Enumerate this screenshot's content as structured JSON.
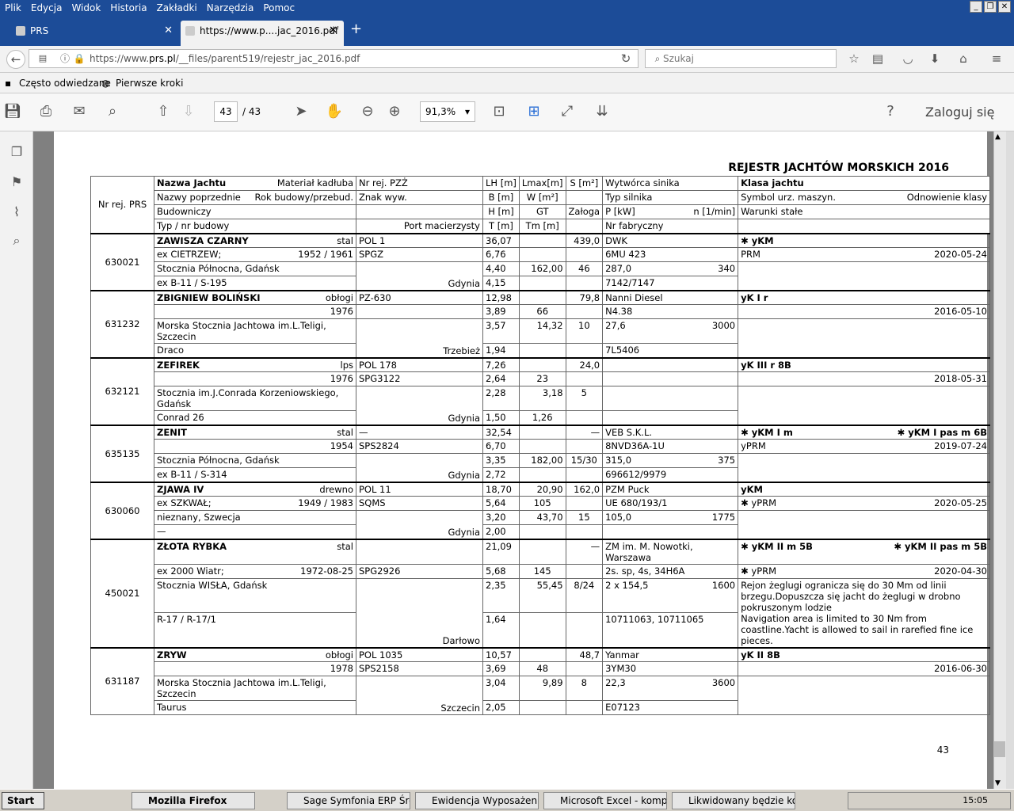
{
  "menu": [
    "Plik",
    "Edycja",
    "Widok",
    "Historia",
    "Zakładki",
    "Narzędzia",
    "Pomoc"
  ],
  "tabs": [
    {
      "label": "PRS"
    },
    {
      "label": "https://www.p....jac_2016.pdf"
    }
  ],
  "url": {
    "prefix": "https://www.",
    "host": "prs.pl",
    "path": "/__files/parent519/rejestr_jac_2016.pdf"
  },
  "search_placeholder": "Szukaj",
  "bookmarks": [
    "Często odwiedzane",
    "Pierwsze kroki"
  ],
  "pdf": {
    "page": "43",
    "total": "/  43",
    "zoom": "91,3%",
    "login": "Zaloguj się"
  },
  "doc_title": "REJESTR JACHTÓW MORSKICH 2016",
  "page_number": "43",
  "header": {
    "nr": "Nr rej. PRS",
    "nazwa": "Nazwa Jachtu",
    "material": "Materiał kadłuba",
    "pzz": "Nr rej. PZŻ",
    "lh": "LH [m]",
    "lmax": "Lmax[m]",
    "s": "S [m²]",
    "wytw": "Wytwórca sinika",
    "klasa": "Klasa jachtu",
    "poprz": "Nazwy poprzednie",
    "rok": "Rok budowy/przebud.",
    "znak": "Znak wyw.",
    "b": "B [m]",
    "w": "W [m²]",
    "typs": "Typ silnika",
    "symbol": "Symbol urz. maszyn.",
    "odnow": "Odnowienie klasy",
    "budow": "Budowniczy",
    "h": "H [m]",
    "gt": "GT",
    "zaloga": "Załoga",
    "p": "P [kW]",
    "n": "n [1/min]",
    "warunki": "Warunki stałe",
    "typ": "Typ / nr budowy",
    "port": "Port macierzysty",
    "t": "T [m]",
    "tm": "Tm [m]",
    "nrf": "Nr fabryczny"
  },
  "rows": [
    {
      "nr": "630021",
      "name": "ZAWISZA CZARNY",
      "mat": "stal",
      "pzz": "POL 1",
      "lh": "36,07",
      "lmax": "",
      "s": "439,0",
      "wytw": "DWK",
      "klasa": "✱ yKM",
      "klasa2": "",
      "poprz": "ex CIETRZEW;",
      "rok": "1952 / 1961",
      "znak": "SPGZ",
      "b": "6,76",
      "w": "",
      "typs": "6MU 423",
      "symbol": "PRM",
      "odnow": "2020-05-24",
      "bud": "Stocznia Północna, Gdańsk",
      "h": "4,40",
      "gt": "162,00",
      "zal": "46",
      "p": "287,0",
      "n": "340",
      "war": "",
      "typ": "ex B-11 / S-195",
      "port": "Gdynia",
      "t": "4,15",
      "tm": "",
      "nrf": "7142/7147"
    },
    {
      "nr": "631232",
      "name": "ZBIGNIEW BOLIŃSKI",
      "mat": "obłogi",
      "pzz": "PZ-630",
      "lh": "12,98",
      "lmax": "",
      "s": "79,8",
      "wytw": "Nanni Diesel",
      "klasa": "yK I r",
      "klasa2": "",
      "poprz": "",
      "rok": "1976",
      "znak": "",
      "b": "3,89",
      "w": "66",
      "typs": "N4.38",
      "symbol": "",
      "odnow": "2016-05-10",
      "bud": "Morska Stocznia Jachtowa im.L.Teligi, Szczecin",
      "h": "3,57",
      "gt": "14,32",
      "zal": "10",
      "p": "27,6",
      "n": "3000",
      "war": "",
      "typ": "Draco",
      "port": "Trzebież",
      "t": "1,94",
      "tm": "",
      "nrf": "7L5406"
    },
    {
      "nr": "632121",
      "name": "ZEFIREK",
      "mat": "lps",
      "pzz": "POL 178",
      "lh": "7,26",
      "lmax": "",
      "s": "24,0",
      "wytw": "",
      "klasa": "yK III r 8B",
      "klasa2": "",
      "poprz": "",
      "rok": "1976",
      "znak": "SPG3122",
      "b": "2,64",
      "w": "23",
      "typs": "",
      "symbol": "",
      "odnow": "2018-05-31",
      "bud": "Stocznia im.J.Conrada Korzeniowskiego, Gdańsk",
      "h": "2,28",
      "gt": "3,18",
      "zal": "5",
      "p": "",
      "n": "",
      "war": "",
      "typ": "Conrad 26",
      "port": "Gdynia",
      "t": "1,50",
      "tm": "1,26",
      "nrf": ""
    },
    {
      "nr": "635135",
      "name": "ZENIT",
      "mat": "stal",
      "pzz": "—",
      "lh": "32,54",
      "lmax": "",
      "s": "—",
      "wytw": "VEB S.K.L.",
      "klasa": "✱ yKM I m",
      "klasa2": "✱ yKM I pas m 6B",
      "poprz": "",
      "rok": "1954",
      "znak": "SPS2824",
      "b": "6,70",
      "w": "",
      "typs": "8NVD36A-1U",
      "symbol": "yPRM",
      "odnow": "2019-07-24",
      "bud": "Stocznia Północna, Gdańsk",
      "h": "3,35",
      "gt": "182,00",
      "zal": "15/30",
      "p": "315,0",
      "n": "375",
      "war": "",
      "typ": "ex B-11 / S-314",
      "port": "Gdynia",
      "t": "2,72",
      "tm": "",
      "nrf": "696612/9979"
    },
    {
      "nr": "630060",
      "name": "ZJAWA IV",
      "mat": "drewno",
      "pzz": "POL 11",
      "lh": "18,70",
      "lmax": "20,90",
      "s": "162,0",
      "wytw": "PZM Puck",
      "klasa": "yKM",
      "klasa2": "",
      "poprz": "ex SZKWAŁ;",
      "rok": "1949 / 1983",
      "znak": "SQMS",
      "b": "5,64",
      "w": "105",
      "typs": "UE 680/193/1",
      "symbol": "✱ yPRM",
      "odnow": "2020-05-25",
      "bud": "nieznany, Szwecja",
      "h": "3,20",
      "gt": "43,70",
      "zal": "15",
      "p": "105,0",
      "n": "1775",
      "war": "",
      "typ": "—",
      "port": "Gdynia",
      "t": "2,00",
      "tm": "",
      "nrf": ""
    },
    {
      "nr": "450021",
      "name": "ZŁOTA RYBKA",
      "mat": "stal",
      "pzz": "",
      "lh": "21,09",
      "lmax": "",
      "s": "—",
      "wytw": "ZM im. M. Nowotki, Warszawa",
      "klasa": "✱ yKM II m 5B",
      "klasa2": "✱ yKM II pas m 5B",
      "poprz": "ex 2000 Wiatr;",
      "rok": "1972-08-25",
      "znak": "SPG2926",
      "b": "5,68",
      "w": "145",
      "typs": "2s. sp, 4s, 34H6A",
      "symbol": "✱ yPRM",
      "odnow": "2020-04-30",
      "bud": "Stocznia WISŁA, Gdańsk",
      "h": "2,35",
      "gt": "55,45",
      "zal": "8/24",
      "p": "2 x 154,5",
      "n": "1600",
      "war": "Rejon żeglugi ogranicza się do 30 Mm od linii brzegu.Dopuszcza się jacht do żeglugi w drobno pokruszonym lodzie",
      "typ": "R-17 / R-17/1",
      "port": "Darłowo",
      "t": "1,64",
      "tm": "",
      "nrf": "10711063, 10711065",
      "war2": "Navigation area is limited to 30 Nm from coastline.Yacht is allowed to sail in rarefied fine ice pieces."
    },
    {
      "nr": "631187",
      "name": "ZRYW",
      "mat": "obłogi",
      "pzz": "POL 1035",
      "lh": "10,57",
      "lmax": "",
      "s": "48,7",
      "wytw": "Yanmar",
      "klasa": "yK II 8B",
      "klasa2": "",
      "poprz": "",
      "rok": "1978",
      "znak": "SPS2158",
      "b": "3,69",
      "w": "48",
      "typs": "3YM30",
      "symbol": "",
      "odnow": "2016-06-30",
      "bud": "Morska Stocznia Jachtowa im.L.Teligi, Szczecin",
      "h": "3,04",
      "gt": "9,89",
      "zal": "8",
      "p": "22,3",
      "n": "3600",
      "war": "",
      "typ": "Taurus",
      "port": "Szczecin",
      "t": "2,05",
      "tm": "",
      "nrf": "E07123"
    }
  ],
  "taskbar": {
    "start": "Start",
    "items": [
      "Mozilla Firefox",
      "Sage Symfonia ERP Środ...",
      "Ewidencja Wyposażenia ...",
      "Microsoft Excel - komput...",
      "Likwidowany będzie kom..."
    ],
    "clock": "15:05"
  }
}
